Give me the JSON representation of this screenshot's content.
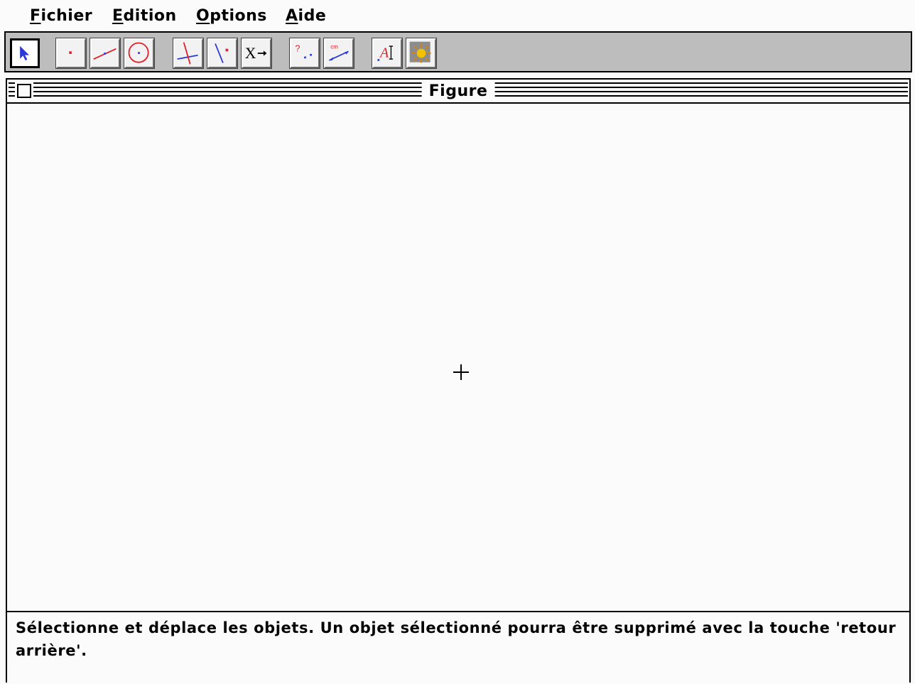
{
  "menubar": {
    "items": [
      {
        "mnemonic": "F",
        "rest": "ichier"
      },
      {
        "mnemonic": "E",
        "rest": "dition"
      },
      {
        "mnemonic": "O",
        "rest": "ptions"
      },
      {
        "mnemonic": "A",
        "rest": "ide"
      }
    ]
  },
  "toolbar": {
    "tools": [
      {
        "icon": "arrow-pointer-icon",
        "selected": true
      },
      {
        "icon": "point-icon"
      },
      {
        "icon": "line-icon"
      },
      {
        "icon": "circle-icon"
      },
      {
        "icon": "perpendicular-icon"
      },
      {
        "icon": "parallel-icon"
      },
      {
        "icon": "transform-x-icon",
        "glyph": "X→"
      },
      {
        "icon": "question-points-icon",
        "glyph": "?"
      },
      {
        "icon": "measure-cm-icon",
        "glyph": "cm"
      },
      {
        "icon": "text-label-icon",
        "glyph": "AI"
      },
      {
        "icon": "hide-show-icon"
      }
    ]
  },
  "window": {
    "title": "Figure"
  },
  "status": {
    "message": "Sélectionne et déplace les objets. Un objet sélectionné pourra être supprimé avec la touche 'retour arrière'."
  },
  "colors": {
    "toolbar_bg": "#bdbdbd",
    "accent_red": "#e0202a",
    "accent_blue": "#2a3ad8",
    "page_bg": "#fbfbfb"
  }
}
